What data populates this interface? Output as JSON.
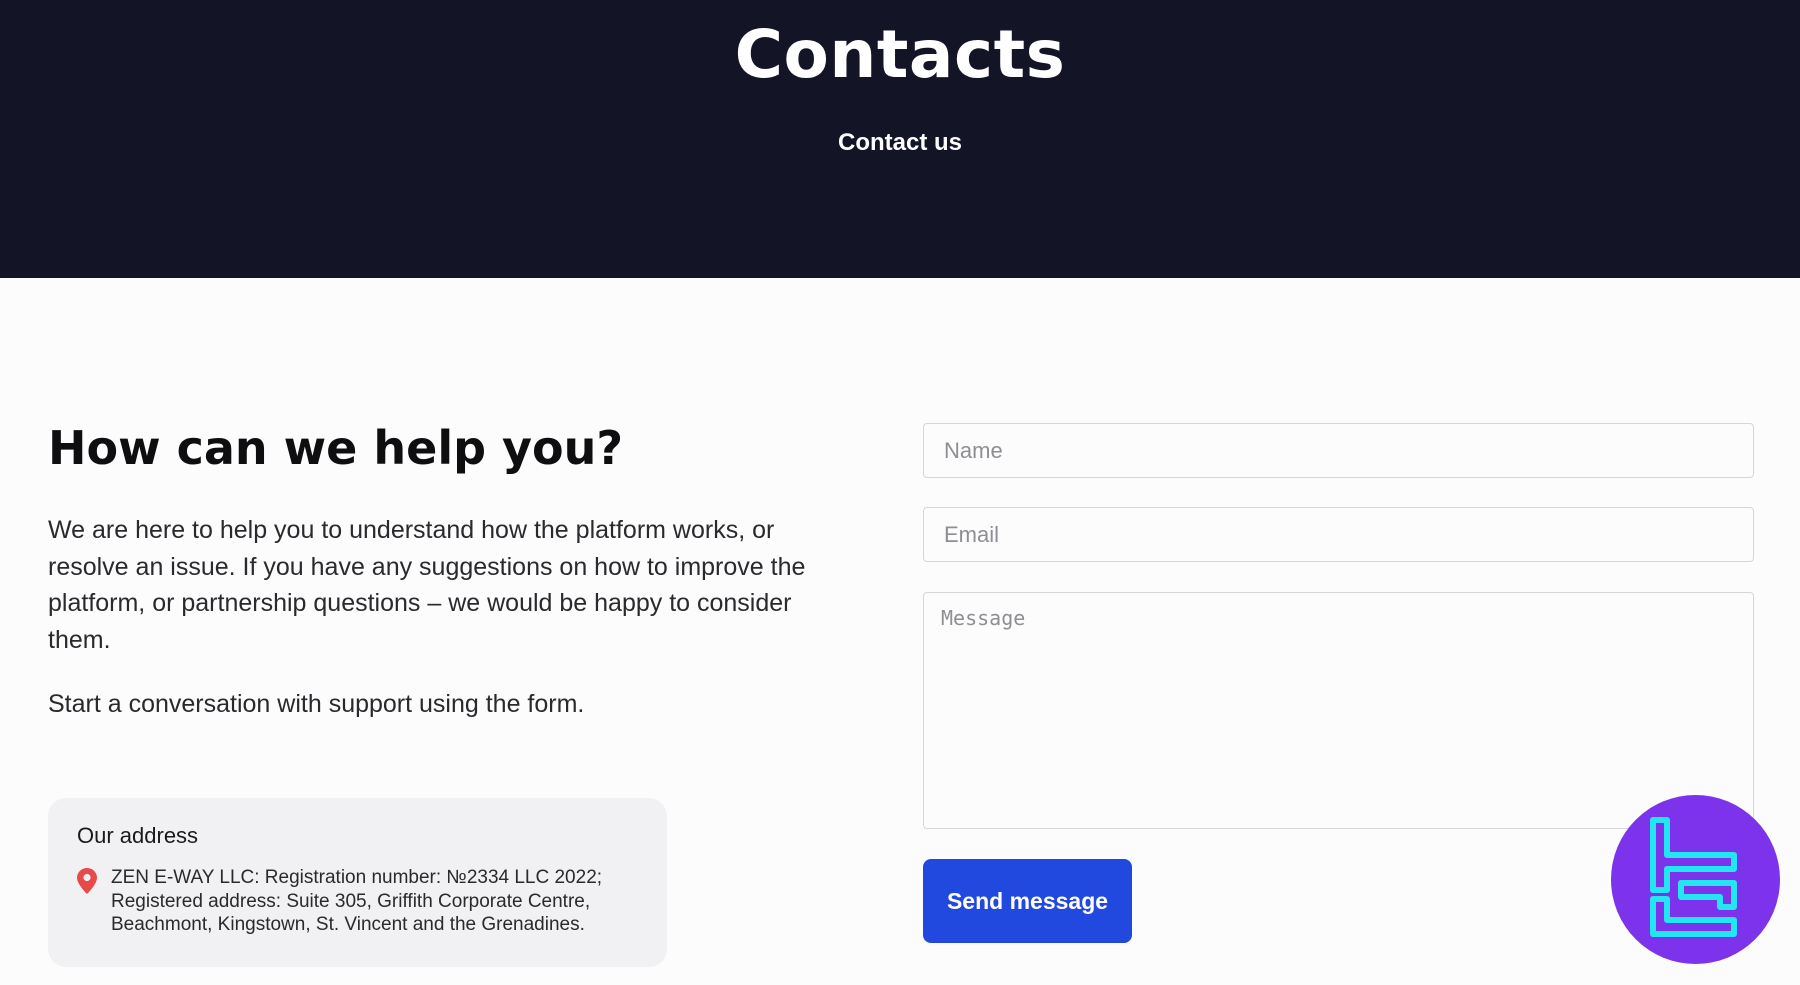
{
  "hero": {
    "title": "Contacts",
    "subtitle": "Contact us"
  },
  "intro": {
    "heading": "How can we help you?",
    "paragraph_1": "We are here to help you to understand how the platform works, or resolve an issue. If you have any suggestions on how to improve the platform, or partnership questions – we would be happy to consider them.",
    "paragraph_2": "Start a conversation with support using the form."
  },
  "address": {
    "title": "Our address",
    "icon": "map-pin-icon",
    "text": "ZEN E-WAY LLC: Registration number: №2334 LLC 2022; Registered address: Suite 305, Griffith Corporate Centre, Beachmont, Kingstown, St. Vincent and the Grenadines."
  },
  "form": {
    "name_placeholder": "Name",
    "email_placeholder": "Email",
    "message_placeholder": "Message",
    "submit_label": "Send message"
  },
  "colors": {
    "hero_background": "#131425",
    "button": "#2149e0",
    "badge": "#7d32eb",
    "badge_logo": "#22e6f2",
    "pin": "#e84a4a"
  },
  "badge": {
    "icon": "tc-logo-icon"
  }
}
